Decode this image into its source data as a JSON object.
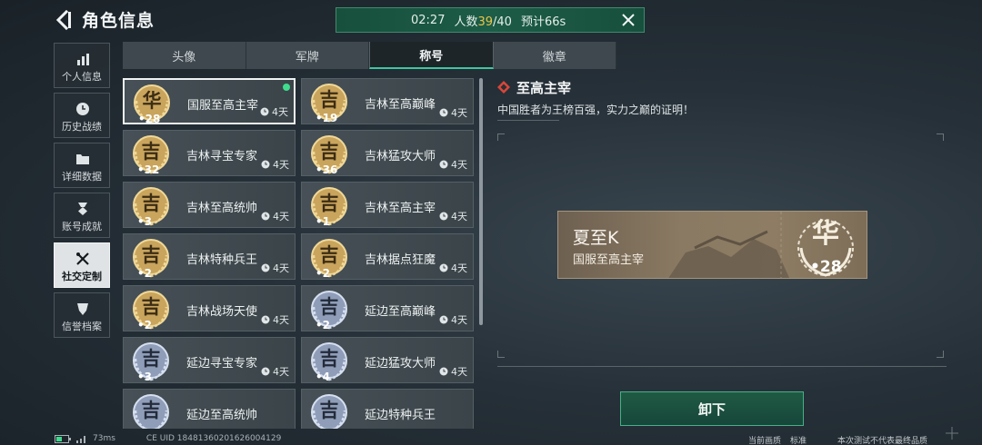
{
  "header": {
    "title": "角色信息",
    "banner": {
      "time": "02:27",
      "count_prefix": "人数",
      "count_current": "39",
      "count_total": "/40",
      "eta": "预计66s"
    }
  },
  "nav": {
    "items": [
      {
        "label": "个人信息",
        "icon": "bar-chart-icon"
      },
      {
        "label": "历史战绩",
        "icon": "clock-icon"
      },
      {
        "label": "详细数据",
        "icon": "folder-icon"
      },
      {
        "label": "账号成就",
        "icon": "medal-icon"
      },
      {
        "label": "社交定制",
        "icon": "tools-icon",
        "active": true
      },
      {
        "label": "信誉档案",
        "icon": "shield-icon"
      }
    ]
  },
  "tabs": [
    "头像",
    "军牌",
    "称号",
    "徽章"
  ],
  "active_tab": "称号",
  "titles": [
    {
      "name": "国服至高主宰",
      "glyph": "华",
      "num": "28",
      "duration": "4天",
      "tier": "gold",
      "selected": true,
      "equipped": true
    },
    {
      "name": "吉林至高巅峰",
      "glyph": "吉",
      "num": "19",
      "duration": "4天",
      "tier": "gold"
    },
    {
      "name": "吉林寻宝专家",
      "glyph": "吉",
      "num": "32",
      "duration": "4天",
      "tier": "gold"
    },
    {
      "name": "吉林猛攻大师",
      "glyph": "吉",
      "num": "36",
      "duration": "4天",
      "tier": "gold"
    },
    {
      "name": "吉林至高统帅",
      "glyph": "吉",
      "num": "3",
      "duration": "4天",
      "tier": "gold"
    },
    {
      "name": "吉林至高主宰",
      "glyph": "吉",
      "num": "1",
      "duration": "4天",
      "tier": "gold"
    },
    {
      "name": "吉林特种兵王",
      "glyph": "吉",
      "num": "2",
      "duration": "4天",
      "tier": "gold"
    },
    {
      "name": "吉林据点狂魔",
      "glyph": "吉",
      "num": "2",
      "duration": "4天",
      "tier": "gold"
    },
    {
      "name": "吉林战场天使",
      "glyph": "吉",
      "num": "2",
      "duration": "4天",
      "tier": "gold"
    },
    {
      "name": "延边至高巅峰",
      "glyph": "吉",
      "num": "2",
      "duration": "4天",
      "tier": "silver"
    },
    {
      "name": "延边寻宝专家",
      "glyph": "吉",
      "num": "3",
      "duration": "4天",
      "tier": "silver"
    },
    {
      "name": "延边猛攻大师",
      "glyph": "吉",
      "num": "4",
      "duration": "4天",
      "tier": "silver"
    },
    {
      "name": "延边至高统帅",
      "glyph": "吉",
      "num": "",
      "duration": "",
      "tier": "silver"
    },
    {
      "name": "延边特种兵王",
      "glyph": "吉",
      "num": "",
      "duration": "",
      "tier": "silver"
    }
  ],
  "detail": {
    "title": "至高主宰",
    "description": "中国胜者为王榜百强，实力之巅的证明！",
    "plate": {
      "player_name": "夏至K",
      "title_text": "国服至高主宰",
      "glyph": "华",
      "num": "28"
    },
    "unequip_label": "卸下"
  },
  "footer": {
    "ping": "73ms",
    "uid_text": "CE UID 18481360201626004129",
    "quality_label": "当前画质",
    "quality_value": "标准",
    "disclaimer": "本次测试不代表最终品质"
  },
  "colors": {
    "accent_green": "#3fc6a0",
    "gold": "#d6b46a",
    "silver": "#9aa8c2"
  }
}
